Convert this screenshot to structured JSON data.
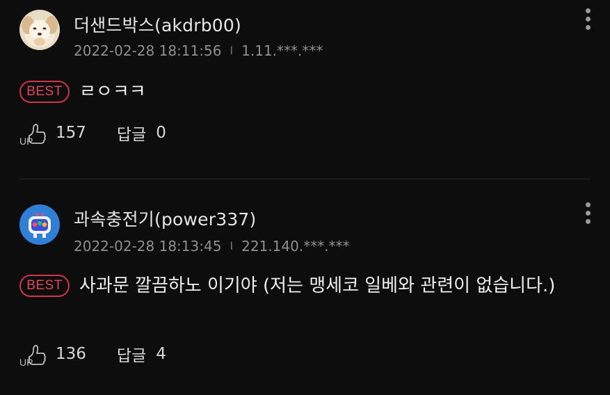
{
  "comments": [
    {
      "username": "더샌드박스(akdrb00)",
      "timestamp": "2022-02-28 18:11:56",
      "separator": "I",
      "ip": "1.11.***.***",
      "badge": "BEST",
      "text": "ㄹㅇㅋㅋ",
      "up_count": "157",
      "reply_label": "답글",
      "reply_count": "0",
      "avatar": "puppy-avatar"
    },
    {
      "username": "과속충전기(power337)",
      "timestamp": "2022-02-28 18:13:45",
      "separator": "I",
      "ip": "221.140.***.***",
      "badge": "BEST",
      "text": "사과문 깔끔하노 이기야 (저는 맹세코 일베와 관련이 없습니다.)",
      "up_count": "136",
      "reply_label": "답글",
      "reply_count": "4",
      "avatar": "tv-character-avatar"
    }
  ],
  "colors": {
    "background": "#0d0d0d",
    "best_badge": "#d2344a",
    "meta_text": "#8f8f8f",
    "primary_text": "#e6e6e6"
  }
}
